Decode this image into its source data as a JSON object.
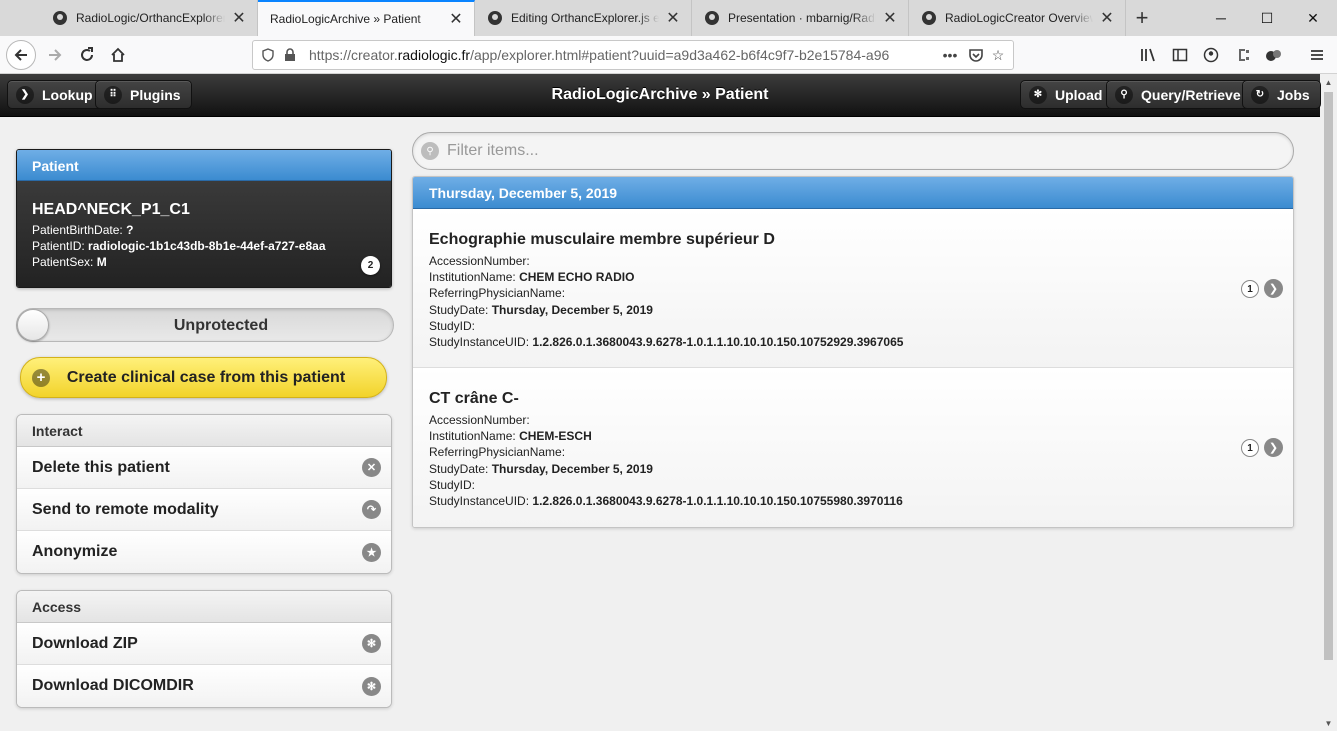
{
  "browser": {
    "tabs": [
      {
        "title": "RadioLogic/OrthancExplorer.js",
        "icon": "github-icon",
        "active": false
      },
      {
        "title": "RadioLogicArchive » Patient",
        "icon": "",
        "active": true
      },
      {
        "title": "Editing OrthancExplorer.js ext",
        "icon": "github-icon",
        "active": false
      },
      {
        "title": "Presentation · mbarnig/RadioL",
        "icon": "github-icon",
        "active": false
      },
      {
        "title": "RadioLogicCreator Overview",
        "icon": "github-icon",
        "active": false
      }
    ],
    "url_prefix": "https://creator.",
    "url_domain": "radiologic.fr",
    "url_suffix": "/app/explorer.html#patient?uuid=a9d3a462-b6f4c9f7-b2e15784-a96"
  },
  "header": {
    "title": "RadioLogicArchive » Patient",
    "lookup": "Lookup",
    "plugins": "Plugins",
    "upload": "Upload",
    "query": "Query/Retrieve",
    "jobs": "Jobs"
  },
  "patient": {
    "section_title": "Patient",
    "name": "HEAD^NECK_P1_C1",
    "birthdate_label": "PatientBirthDate:",
    "birthdate_value": "?",
    "id_label": "PatientID:",
    "id_value": "radiologic-1b1c43db-8b1e-44ef-a727-e8aa",
    "sex_label": "PatientSex:",
    "sex_value": "M",
    "study_count": "2"
  },
  "protection": {
    "label": "Unprotected"
  },
  "create_case": {
    "label": "Create clinical case from this patient"
  },
  "interact": {
    "title": "Interact",
    "items": [
      {
        "label": "Delete this patient",
        "icon": "delete-icon"
      },
      {
        "label": "Send to remote modality",
        "icon": "forward-icon"
      },
      {
        "label": "Anonymize",
        "icon": "star-icon"
      }
    ]
  },
  "access": {
    "title": "Access",
    "items": [
      {
        "label": "Download ZIP",
        "icon": "gear-icon"
      },
      {
        "label": "Download DICOMDIR",
        "icon": "gear-icon"
      }
    ]
  },
  "filter": {
    "placeholder": "Filter items..."
  },
  "studies": {
    "date_divider": "Thursday, December 5, 2019",
    "items": [
      {
        "title": "Echographie musculaire membre supérieur D",
        "accession_label": "AccessionNumber:",
        "accession_value": "",
        "institution_label": "InstitutionName:",
        "institution_value": "CHEM ECHO RADIO",
        "referring_label": "ReferringPhysicianName:",
        "referring_value": "",
        "date_label": "StudyDate:",
        "date_value": "Thursday, December 5, 2019",
        "studyid_label": "StudyID:",
        "studyid_value": "",
        "uid_label": "StudyInstanceUID:",
        "uid_value": "1.2.826.0.1.3680043.9.6278-1.0.1.1.10.10.10.150.10752929.3967065",
        "series_count": "1"
      },
      {
        "title": "CT crâne C-",
        "accession_label": "AccessionNumber:",
        "accession_value": "",
        "institution_label": "InstitutionName:",
        "institution_value": "CHEM-ESCH",
        "referring_label": "ReferringPhysicianName:",
        "referring_value": "",
        "date_label": "StudyDate:",
        "date_value": "Thursday, December 5, 2019",
        "studyid_label": "StudyID:",
        "studyid_value": "",
        "uid_label": "StudyInstanceUID:",
        "uid_value": "1.2.826.0.1.3680043.9.6278-1.0.1.1.10.10.10.150.10755980.3970116",
        "series_count": "1"
      }
    ]
  },
  "colors": {
    "header_bar": "#1f1f1f",
    "divider_blue": "#4a98da",
    "create_yellow": "#f6dd3a"
  }
}
